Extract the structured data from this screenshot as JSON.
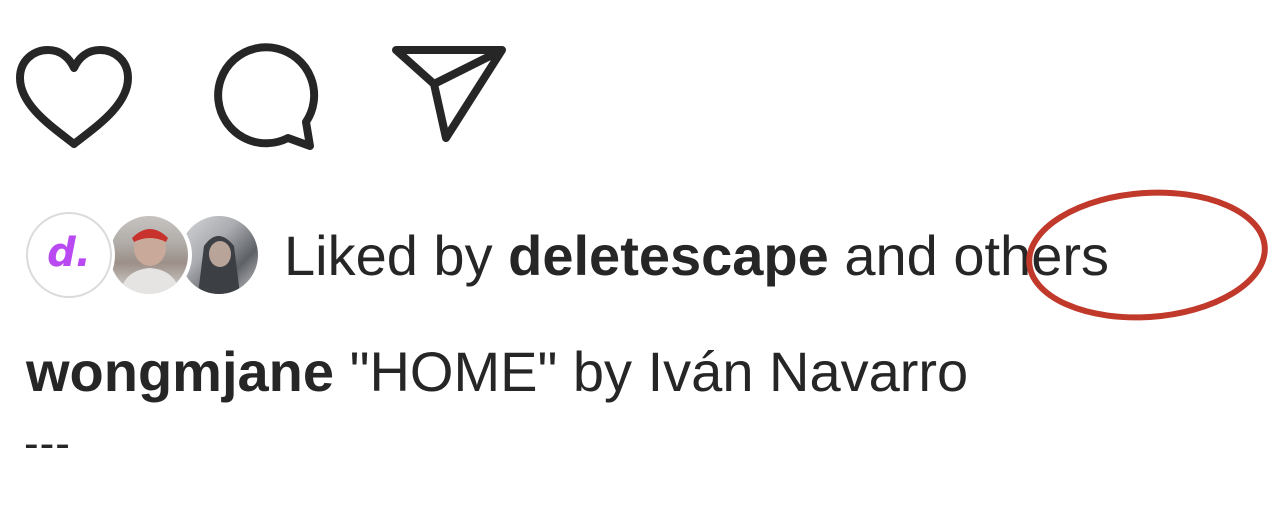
{
  "actions": {
    "like_icon": "heart-icon",
    "comment_icon": "speech-bubble-icon",
    "share_icon": "paper-plane-icon"
  },
  "likes": {
    "avatar_initial": "d.",
    "prefix": "Liked by ",
    "user": "deletescape",
    "middle": " and ",
    "others": "others",
    "avatar_accent": "#b94af2"
  },
  "caption": {
    "username": "wongmjane",
    "text": " \"HOME\" by Iván Navarro"
  },
  "dashes": "---",
  "annotation_color": "#c0392b"
}
